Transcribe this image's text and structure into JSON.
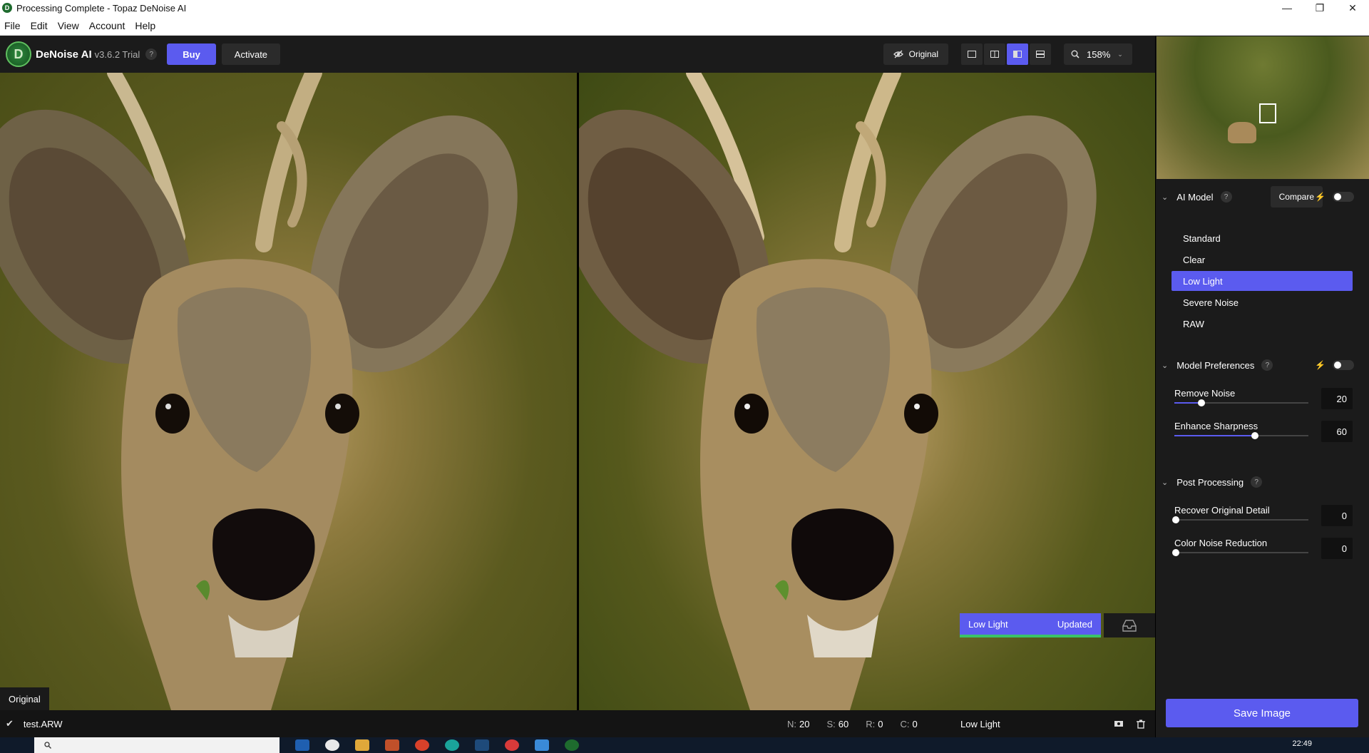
{
  "window": {
    "title": "Processing Complete - Topaz DeNoise AI"
  },
  "menu": [
    "File",
    "Edit",
    "View",
    "Account",
    "Help"
  ],
  "toolbar": {
    "product": "DeNoise AI",
    "version": "v3.6.2 Trial",
    "help": "?",
    "buy_label": "Buy",
    "activate_label": "Activate",
    "original_label": "Original",
    "zoom_label": "158%"
  },
  "viewer": {
    "left_label": "Original",
    "model_tag": "Low Light",
    "model_status": "Updated"
  },
  "status": {
    "filename": "test.ARW",
    "n_key": "N:",
    "n_val": "20",
    "s_key": "S:",
    "s_val": "60",
    "r_key": "R:",
    "r_val": "0",
    "c_key": "C:",
    "c_val": "0",
    "model": "Low Light"
  },
  "sidebar": {
    "ai_model": {
      "title": "AI Model",
      "compare_label": "Compare",
      "items": [
        "Standard",
        "Clear",
        "Low Light",
        "Severe Noise",
        "RAW"
      ],
      "selected": "Low Light"
    },
    "prefs": {
      "title": "Model Preferences",
      "sliders": [
        {
          "label": "Remove Noise",
          "value": "20",
          "fraction": 0.2
        },
        {
          "label": "Enhance Sharpness",
          "value": "60",
          "fraction": 0.6
        }
      ]
    },
    "post": {
      "title": "Post Processing",
      "sliders": [
        {
          "label": "Recover Original Detail",
          "value": "0",
          "fraction": 0
        },
        {
          "label": "Color Noise Reduction",
          "value": "0",
          "fraction": 0
        }
      ]
    },
    "save_label": "Save Image"
  },
  "taskbar": {
    "time": "22:49"
  },
  "colors": {
    "accent": "#5b5bef",
    "success": "#3ac26a"
  }
}
